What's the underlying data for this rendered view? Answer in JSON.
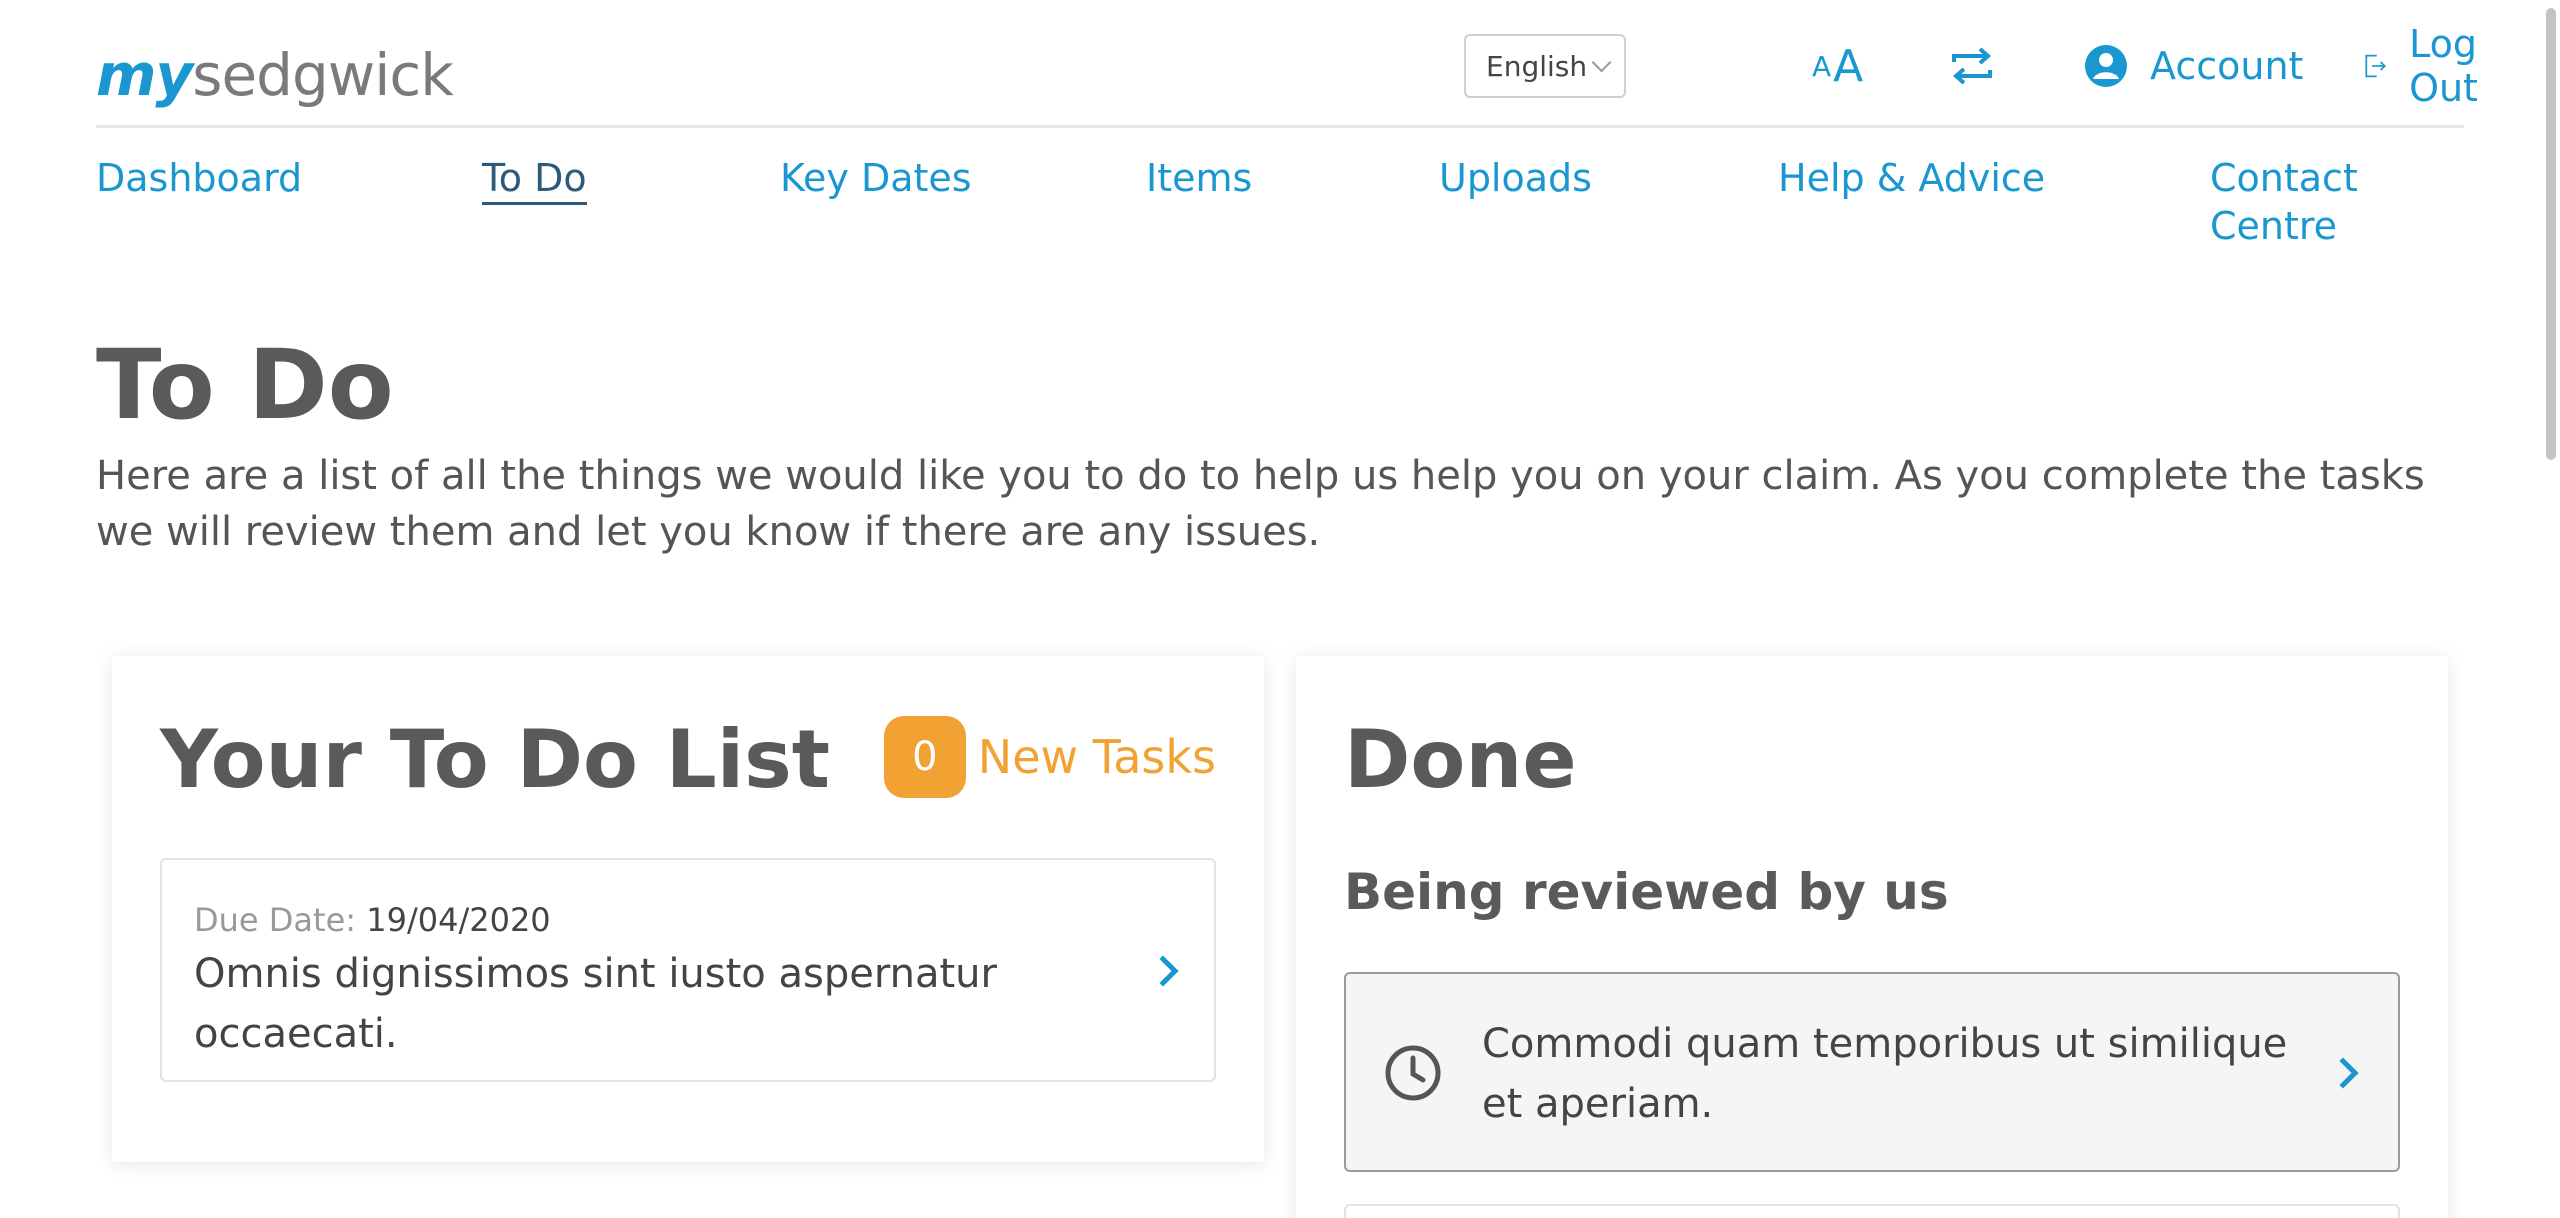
{
  "header": {
    "logo_my": "my",
    "logo_brand": "sedgwick",
    "language": "English",
    "text_size_small": "A",
    "text_size_large": "A",
    "account": "Account",
    "logout": "Log Out"
  },
  "nav": {
    "items": [
      {
        "label": "Dashboard"
      },
      {
        "label": "To Do"
      },
      {
        "label": "Key Dates"
      },
      {
        "label": "Items"
      },
      {
        "label": "Uploads"
      },
      {
        "label": "Help & Advice"
      },
      {
        "label": "Contact Centre"
      }
    ],
    "active": "To Do"
  },
  "page": {
    "title": "To Do",
    "intro": "Here are a list of all the things we would like you to do to help us help you on your claim. As you complete the tasks we will review them and let you know if there are any issues."
  },
  "todo": {
    "title": "Your To Do List",
    "new_count": "0",
    "new_label": "New Tasks",
    "items": [
      {
        "due_label": "Due Date:",
        "due_value": "19/04/2020",
        "text": "Omnis dignissimos sint iusto aspernatur occaecati."
      }
    ]
  },
  "done": {
    "title": "Done",
    "subtitle": "Being reviewed by us",
    "items": [
      {
        "text": "Commodi quam temporibus ut similique et aperiam."
      }
    ]
  },
  "colors": {
    "accent": "#1a97d1",
    "badge": "#f2a232",
    "heading": "#5a5a5a"
  },
  "icons": [
    "text-size-icon",
    "swap-icon",
    "account-icon",
    "logout-icon",
    "chevron-right-icon",
    "clock-icon"
  ]
}
